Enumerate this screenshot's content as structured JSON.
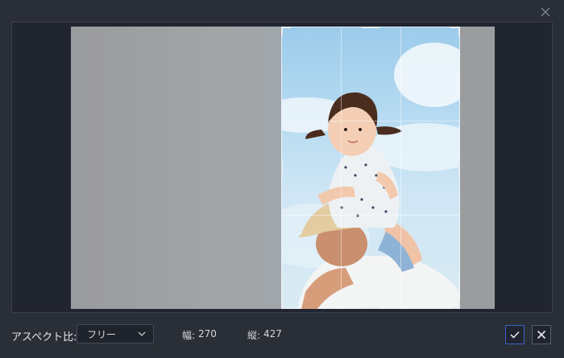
{
  "dialog": {
    "close_icon": "close-icon"
  },
  "editor": {
    "crop_overlay_color": "#9b9c9e",
    "photo_description_icon": "photo"
  },
  "toolbar": {
    "aspect_label": "アスペクト比:",
    "aspect_value": "フリー",
    "width_label": "幅:",
    "width_value": "270",
    "height_label": "縦:",
    "height_value": "427",
    "confirm_icon": "check-icon",
    "cancel_icon": "close-icon",
    "confirm_border_color": "#3b67c8"
  }
}
